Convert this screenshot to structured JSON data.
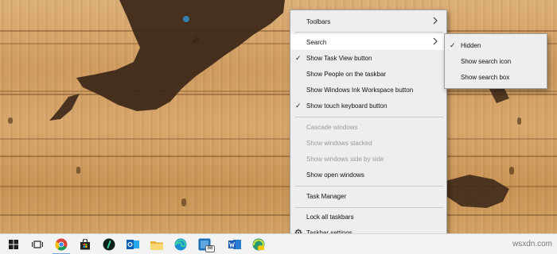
{
  "context_menu": {
    "items": [
      {
        "label": "Toolbars",
        "submenu": true
      },
      {
        "label": "Search",
        "submenu": true,
        "highlighted": true
      },
      {
        "label": "Show Task View button",
        "checked": true
      },
      {
        "label": "Show People on the taskbar"
      },
      {
        "label": "Show Windows Ink Workspace button"
      },
      {
        "label": "Show touch keyboard button",
        "checked": true
      },
      {
        "label": "Cascade windows",
        "disabled": true
      },
      {
        "label": "Show windows stacked",
        "disabled": true
      },
      {
        "label": "Show windows side by side",
        "disabled": true
      },
      {
        "label": "Show open windows"
      },
      {
        "label": "Task Manager"
      },
      {
        "label": "Lock all taskbars"
      },
      {
        "label": "Taskbar settings",
        "icon": "gear-icon"
      }
    ]
  },
  "search_submenu": {
    "items": [
      {
        "label": "Hidden",
        "checked": true
      },
      {
        "label": "Show search icon"
      },
      {
        "label": "Show search box"
      }
    ]
  },
  "taskbar": {
    "apps": [
      {
        "name": "start-button",
        "icon": "windows-logo-icon"
      },
      {
        "name": "task-view-button",
        "icon": "task-view-icon"
      },
      {
        "name": "chrome-button",
        "icon": "chrome-icon",
        "active": true
      },
      {
        "name": "store-button",
        "icon": "store-icon"
      },
      {
        "name": "app-button",
        "icon": "circle-app-icon"
      },
      {
        "name": "outlook-button",
        "icon": "outlook-icon"
      },
      {
        "name": "file-explorer-button",
        "icon": "folder-icon"
      },
      {
        "name": "edge-button",
        "icon": "edge-icon"
      },
      {
        "name": "app-88-button",
        "icon": "app-tile-icon",
        "badge": "88"
      },
      {
        "name": "word-button",
        "icon": "word-icon"
      },
      {
        "name": "edge-canary-button",
        "icon": "edge-canary-icon"
      }
    ]
  },
  "watermark": "wsxdn.com"
}
